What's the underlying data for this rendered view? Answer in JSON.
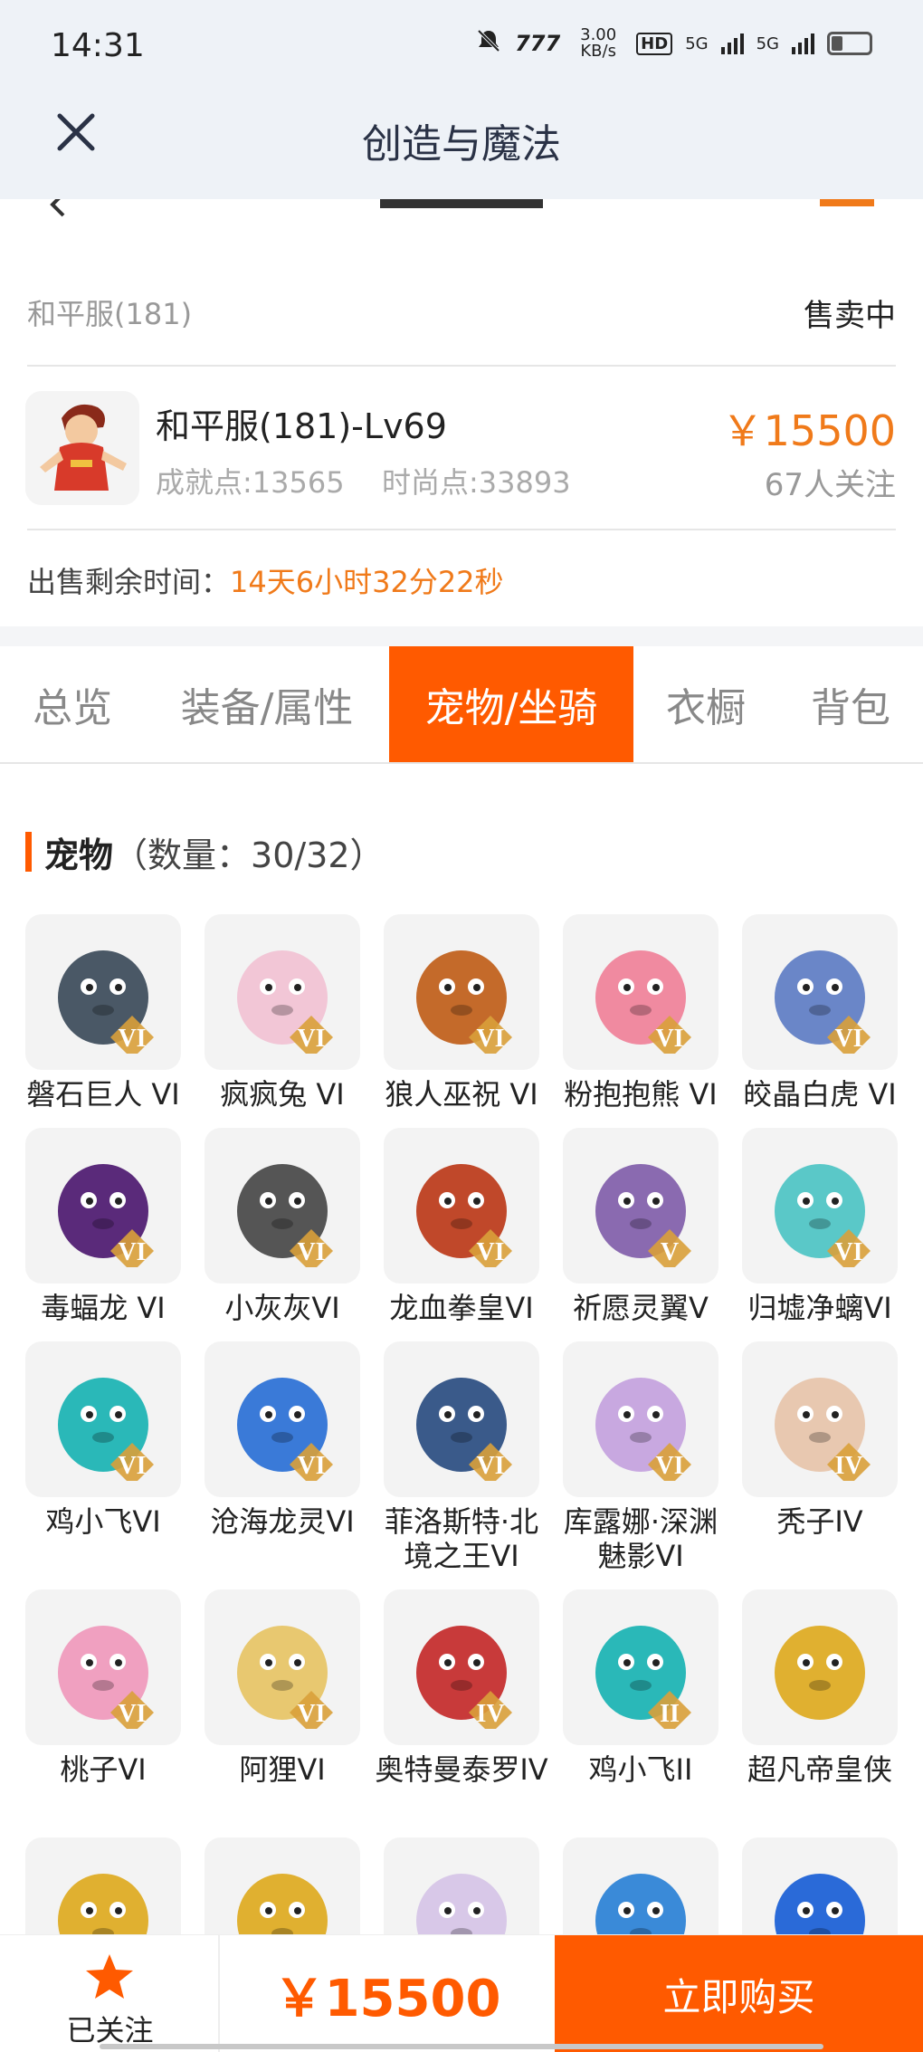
{
  "status": {
    "time": "14:31",
    "speed": "3.00 KB/s",
    "hd": "HD",
    "net1": "5G",
    "net2": "5G"
  },
  "app": {
    "title": "创造与魔法"
  },
  "server": {
    "name": "和平服(181)",
    "status": "售卖中"
  },
  "character": {
    "name": "和平服(181)-Lv69",
    "achievement": "成就点:13565",
    "fashion": "时尚点:33893",
    "price": "￥15500",
    "followers": "67人关注"
  },
  "timer": {
    "label": "出售剩余时间：",
    "value": "14天6小时32分22秒"
  },
  "tabs": [
    "总览",
    "装备/属性",
    "宠物/坐骑",
    "衣橱",
    "背包"
  ],
  "active_tab": "宠物/坐骑",
  "section": {
    "title": "宠物",
    "count": "（数量：30/32）"
  },
  "pets": [
    {
      "name": "磐石巨人 VI",
      "grade": "VI",
      "color": "#4a5866"
    },
    {
      "name": "疯疯兔 VI",
      "grade": "VI",
      "color": "#f2c6d6"
    },
    {
      "name": "狼人巫祝 VI",
      "grade": "VI",
      "color": "#c46a2a"
    },
    {
      "name": "粉抱抱熊 VI",
      "grade": "VI",
      "color": "#f08aa0"
    },
    {
      "name": "皎晶白虎 VI",
      "grade": "VI",
      "color": "#6a86c8"
    },
    {
      "name": "毒蝠龙 VI",
      "grade": "VI",
      "color": "#5a2a7a"
    },
    {
      "name": "小灰灰VI",
      "grade": "VI",
      "color": "#555555"
    },
    {
      "name": "龙血拳皇VI",
      "grade": "VI",
      "color": "#c0482a"
    },
    {
      "name": "祈愿灵翼V",
      "grade": "V",
      "color": "#8a6ab0"
    },
    {
      "name": "归墟净螭VI",
      "grade": "VI",
      "color": "#5ac8c8"
    },
    {
      "name": "鸡小飞VI",
      "grade": "VI",
      "color": "#2ab8b8"
    },
    {
      "name": "沧海龙灵VI",
      "grade": "VI",
      "color": "#3a7ad8"
    },
    {
      "name": "菲洛斯特·北境之王VI",
      "grade": "VI",
      "color": "#3a5a8a"
    },
    {
      "name": "库露娜·深渊魅影VI",
      "grade": "VI",
      "color": "#c8a8e0"
    },
    {
      "name": "秃子IV",
      "grade": "IV",
      "color": "#e8c8b0"
    },
    {
      "name": "桃子VI",
      "grade": "VI",
      "color": "#f0a0c0"
    },
    {
      "name": "阿狸VI",
      "grade": "VI",
      "color": "#e8c870"
    },
    {
      "name": "奥特曼泰罗IV",
      "grade": "IV",
      "color": "#c83a3a"
    },
    {
      "name": "鸡小飞II",
      "grade": "II",
      "color": "#2ab8b8"
    },
    {
      "name": "超凡帝皇侠",
      "grade": "",
      "color": "#e0b030"
    },
    {
      "name": "",
      "grade": "",
      "color": "#e0b030"
    },
    {
      "name": "",
      "grade": "",
      "color": "#e0b030"
    },
    {
      "name": "",
      "grade": "",
      "color": "#d8c8e8"
    },
    {
      "name": "",
      "grade": "",
      "color": "#3a8ad8"
    },
    {
      "name": "",
      "grade": "",
      "color": "#2a6ad8"
    }
  ],
  "bottom": {
    "follow_label": "已关注",
    "price": "￥15500",
    "buy_label": "立即购买"
  }
}
